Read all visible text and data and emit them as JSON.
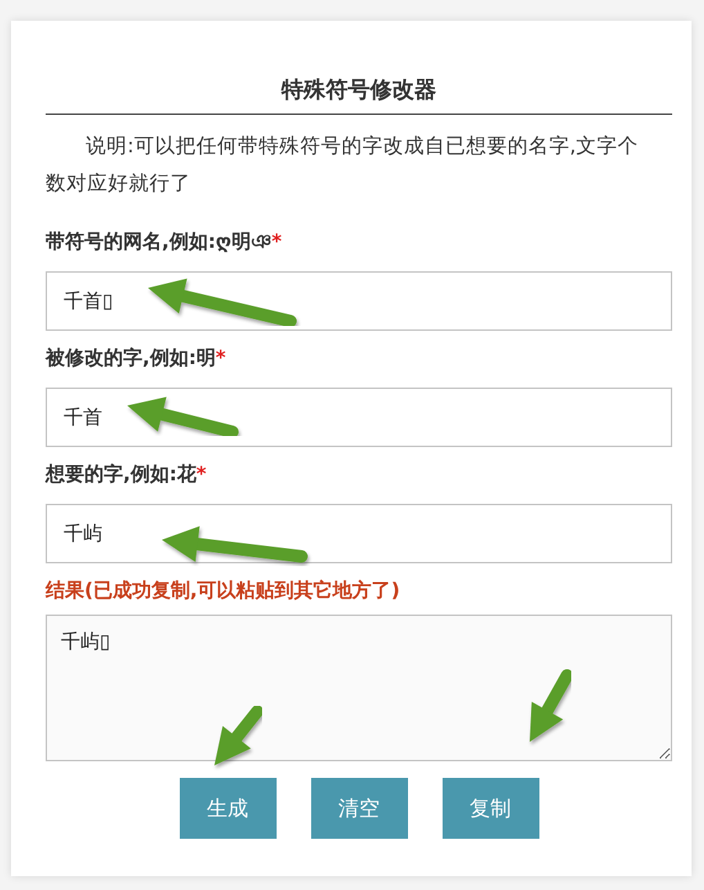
{
  "title": "特殊符号修改器",
  "description": "说明:可以把任何带特殊符号的字改成自已想要的名字,文字个数对应好就行了",
  "fields": [
    {
      "label": "带符号的网名,例如:ღ明ঞ",
      "required_mark": "*",
      "value": "千首▯"
    },
    {
      "label": "被修改的字,例如:明",
      "required_mark": "*",
      "value": "千首"
    },
    {
      "label": "想要的字,例如:花",
      "required_mark": "*",
      "value": "千屿"
    }
  ],
  "result": {
    "label": "结果(已成功复制,可以粘贴到其它地方了)",
    "value": "千屿▯"
  },
  "buttons": [
    "生成",
    "清空",
    "复制"
  ]
}
